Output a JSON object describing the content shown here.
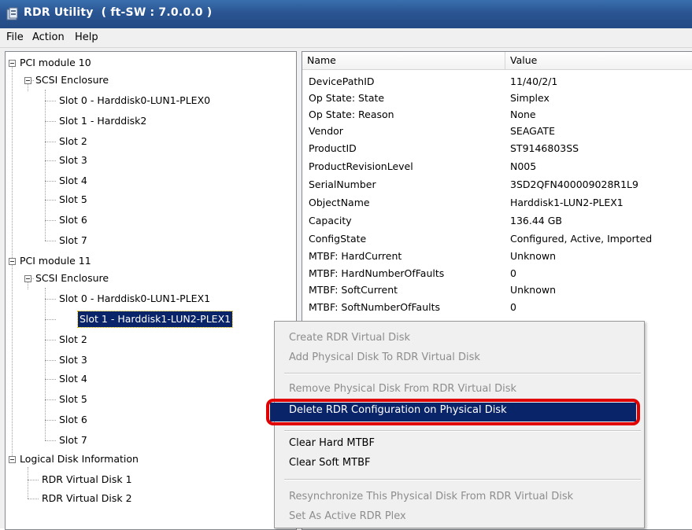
{
  "window": {
    "title": "RDR Utility  ( ft-SW : 7.0.0.0 )",
    "icon": "application-icon"
  },
  "menu": {
    "items": [
      "File",
      "Action",
      "Help"
    ]
  },
  "tree": {
    "pci10": "PCI module 10",
    "pci10_scsi": "SCSI Enclosure",
    "pci10_slots": [
      "Slot 0  -  Harddisk0-LUN1-PLEX0",
      "Slot 1  -  Harddisk2",
      "Slot 2",
      "Slot 3",
      "Slot 4",
      "Slot 5",
      "Slot 6",
      "Slot 7"
    ],
    "pci11": "PCI module 11",
    "pci11_scsi": "SCSI Enclosure",
    "pci11_slots": [
      "Slot 0  -  Harddisk0-LUN1-PLEX1",
      "Slot 1  -  Harddisk1-LUN2-PLEX1",
      "Slot 2",
      "Slot 3",
      "Slot 4",
      "Slot 5",
      "Slot 6",
      "Slot 7"
    ],
    "logical": "Logical Disk Information",
    "logical_items": [
      "RDR Virtual Disk 1",
      "RDR Virtual Disk 2"
    ]
  },
  "list": {
    "columns": [
      "Name",
      "Value"
    ],
    "rows": [
      [
        "DevicePathID",
        "11/40/2/1"
      ],
      [
        "Op State: State",
        "Simplex"
      ],
      [
        "Op State: Reason",
        "None"
      ],
      [
        "Vendor",
        "SEAGATE"
      ],
      [
        "ProductID",
        "ST9146803SS"
      ],
      [
        "ProductRevisionLevel",
        "N005"
      ],
      [
        "SerialNumber",
        "3SD2QFN400009028R1L9"
      ],
      [
        "ObjectName",
        "Harddisk1-LUN2-PLEX1"
      ],
      [
        "Capacity",
        "136.44 GB"
      ],
      [
        "ConfigState",
        "Configured, Active, Imported"
      ],
      [
        "MTBF: HardCurrent",
        "Unknown"
      ],
      [
        "MTBF: HardNumberOfFaults",
        "0"
      ],
      [
        "MTBF: SoftCurrent",
        "Unknown"
      ],
      [
        "MTBF: SoftNumberOfFaults",
        "0"
      ]
    ]
  },
  "context_menu": {
    "create": "Create RDR Virtual Disk",
    "add": "Add Physical Disk To RDR Virtual Disk",
    "remove": "Remove Physical Disk From RDR Virtual Disk",
    "delete": "Delete RDR Configuration on Physical Disk",
    "clear_hard": "Clear Hard MTBF",
    "clear_soft": "Clear Soft MTBF",
    "resync": "Resynchronize This Physical Disk From RDR Virtual Disk",
    "set_active": "Set As Active RDR Plex"
  },
  "colors": {
    "selection": "#0a246a",
    "highlight_border": "#e00000",
    "titlebar": "#2a5592"
  }
}
